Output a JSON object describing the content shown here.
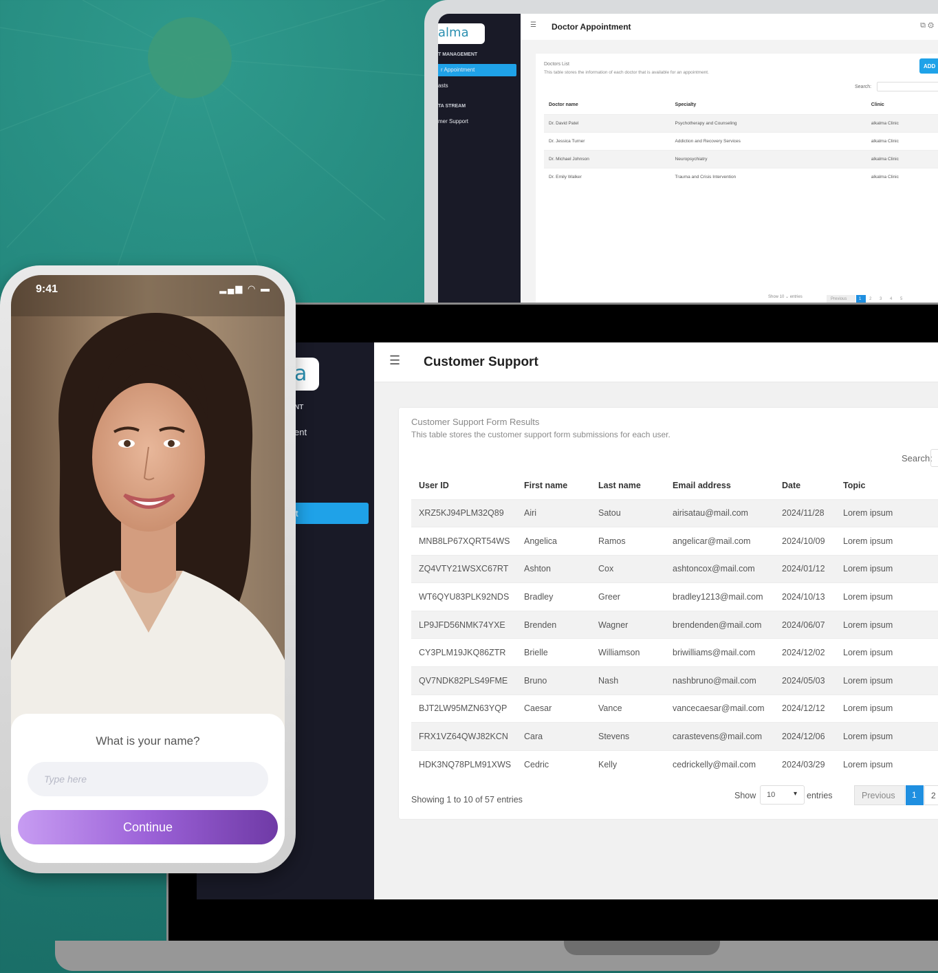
{
  "tablet": {
    "logo": "alma",
    "sidebar": {
      "section1": "T MANAGEMENT",
      "active_item": "r Appointment",
      "item2": "asts",
      "section2": "TA STREAM",
      "item3": "mer Support"
    },
    "header": {
      "title": "Doctor Appointment"
    },
    "card": {
      "title": "Doctors List",
      "description": "This table stores the information of each doctor that is available for an appointment.",
      "add_button": "ADD",
      "search_label": "Search:"
    },
    "table": {
      "headers": [
        "Doctor name",
        "Specialty",
        "Clinic"
      ],
      "rows": [
        [
          "Dr. David Patel",
          "Psychotherapy and Counseling",
          "alkalma Clinic"
        ],
        [
          "Dr. Jessica Turner",
          "Addiction and Recovery Services",
          "alkalma Clinic"
        ],
        [
          "Dr. Michael Johnson",
          "Neuropsychiatry",
          "alkalma Clinic"
        ],
        [
          "Dr. Emily Walker",
          "Trauma and Crisis Intervention",
          "alkalma Clinic"
        ]
      ]
    },
    "footer": {
      "show": "Show",
      "entries": "entries",
      "previous": "Previous",
      "pages": [
        "1",
        "2",
        "3",
        "4",
        "5"
      ]
    }
  },
  "laptop": {
    "logo": "a",
    "sidebar": {
      "small_label": "NT",
      "item1": "ent",
      "active_item": "t"
    },
    "header": {
      "title": "Customer Support"
    },
    "card": {
      "title": "Customer Support Form Results",
      "description": "This table stores the customer support form submissions for each user.",
      "search_label": "Search:"
    },
    "table": {
      "headers": [
        "User ID",
        "First name",
        "Last name",
        "Email address",
        "Date",
        "Topic"
      ],
      "rows": [
        [
          "XRZ5KJ94PLM32Q89",
          "Airi",
          "Satou",
          "airisatau@mail.com",
          "2024/11/28",
          "Lorem ipsum"
        ],
        [
          "MNB8LP67XQRT54WS",
          "Angelica",
          "Ramos",
          "angelicar@mail.com",
          "2024/10/09",
          "Lorem ipsum"
        ],
        [
          "ZQ4VTY21WSXC67RT",
          "Ashton",
          "Cox",
          "ashtoncox@mail.com",
          "2024/01/12",
          "Lorem ipsum"
        ],
        [
          "WT6QYU83PLK92NDS",
          "Bradley",
          "Greer",
          "bradley1213@mail.com",
          "2024/10/13",
          "Lorem ipsum"
        ],
        [
          "LP9JFD56NMK74YXE",
          "Brenden",
          "Wagner",
          "brendenden@mail.com",
          "2024/06/07",
          "Lorem ipsum"
        ],
        [
          "CY3PLM19JKQ86ZTR",
          "Brielle",
          "Williamson",
          "briwilliams@mail.com",
          "2024/12/02",
          "Lorem ipsum"
        ],
        [
          "QV7NDK82PLS49FME",
          "Bruno",
          "Nash",
          "nashbruno@mail.com",
          "2024/05/03",
          "Lorem ipsum"
        ],
        [
          "BJT2LW95MZN63YQP",
          "Caesar",
          "Vance",
          "vancecaesar@mail.com",
          "2024/12/12",
          "Lorem ipsum"
        ],
        [
          "FRX1VZ64QWJ82KCN",
          "Cara",
          "Stevens",
          "carastevens@mail.com",
          "2024/12/06",
          "Lorem ipsum"
        ],
        [
          "HDK3NQ78PLM91XWS",
          "Cedric",
          "Kelly",
          "cedrickelly@mail.com",
          "2024/03/29",
          "Lorem ipsum"
        ]
      ]
    },
    "footer": {
      "showing": "Showing 1 to 10 of 57 entries",
      "show": "Show",
      "page_size": "10",
      "entries": "entries",
      "previous": "Previous",
      "page1": "1",
      "page2": "2"
    }
  },
  "phone": {
    "time": "9:41",
    "status_icons": "signal-icon wifi-icon battery-icon",
    "question": "What is your name?",
    "input_placeholder": "Type here",
    "continue_label": "Continue"
  },
  "colors": {
    "background_teal": "#22857b",
    "accent_blue": "#1fa2e8",
    "sidebar_dark": "#191a27",
    "button_purple_start": "#c79cf2",
    "button_purple_end": "#6f3aa6"
  }
}
